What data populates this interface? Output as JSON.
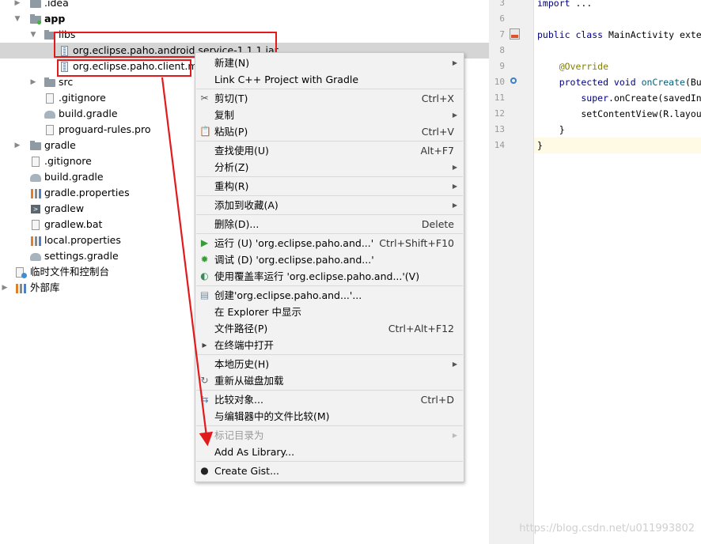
{
  "tree": {
    "items": [
      {
        "label": ".idea",
        "icon": "folder-icon"
      },
      {
        "label": "app",
        "icon": "module-folder-icon"
      },
      {
        "label": "libs",
        "icon": "folder-icon"
      },
      {
        "label": "org.eclipse.paho.android.service-1.1.1.jar",
        "icon": "jar-icon"
      },
      {
        "label": "org.eclipse.paho.client.mqt",
        "icon": "jar-icon"
      },
      {
        "label": "src",
        "icon": "folder-icon"
      },
      {
        "label": ".gitignore",
        "icon": "gitignore-file-icon"
      },
      {
        "label": "build.gradle",
        "icon": "gradle-icon"
      },
      {
        "label": "proguard-rules.pro",
        "icon": "text-file-icon"
      },
      {
        "label": "gradle",
        "icon": "folder-icon"
      },
      {
        "label": ".gitignore",
        "icon": "gitignore-file-icon"
      },
      {
        "label": "build.gradle",
        "icon": "gradle-icon"
      },
      {
        "label": "gradle.properties",
        "icon": "properties-file-icon"
      },
      {
        "label": "gradlew",
        "icon": "terminal-file-icon"
      },
      {
        "label": "gradlew.bat",
        "icon": "text-file-icon"
      },
      {
        "label": "local.properties",
        "icon": "properties-file-icon"
      },
      {
        "label": "settings.gradle",
        "icon": "gradle-icon"
      },
      {
        "label": "临时文件和控制台",
        "icon": "scratches-icon"
      },
      {
        "label": "外部库",
        "icon": "external-libraries-icon"
      }
    ]
  },
  "editor": {
    "line_numbers": [
      "3",
      "6",
      "7",
      "8",
      "9",
      "10",
      "11",
      "12",
      "13",
      "14"
    ],
    "lines": [
      {
        "tokens": [
          {
            "t": "import ",
            "c": "kw"
          },
          {
            "t": "...",
            "c": ""
          }
        ]
      },
      {
        "tokens": []
      },
      {
        "tokens": [
          {
            "t": "public class ",
            "c": "kw"
          },
          {
            "t": "MainActivity exte",
            "c": ""
          }
        ]
      },
      {
        "tokens": []
      },
      {
        "tokens": [
          {
            "t": "    @Override",
            "c": "ann"
          }
        ]
      },
      {
        "tokens": [
          {
            "t": "    protected void ",
            "c": "kw"
          },
          {
            "t": "onCreate",
            "c": "fn"
          },
          {
            "t": "(Bu",
            "c": ""
          }
        ]
      },
      {
        "tokens": [
          {
            "t": "        super",
            "c": "kw"
          },
          {
            "t": ".onCreate(savedIn",
            "c": ""
          }
        ]
      },
      {
        "tokens": [
          {
            "t": "        setContentView(R.layou",
            "c": ""
          }
        ]
      },
      {
        "tokens": [
          {
            "t": "    }",
            "c": ""
          }
        ]
      },
      {
        "tokens": [
          {
            "t": "}",
            "c": ""
          }
        ]
      }
    ]
  },
  "watermark": "https://blog.csdn.net/u011993802",
  "context_menu": {
    "items": [
      {
        "label": "新建(N)",
        "shortcut": "",
        "submenu": true,
        "icon": ""
      },
      {
        "label": "Link C++ Project with Gradle",
        "shortcut": "",
        "submenu": false,
        "icon": ""
      },
      {
        "label": "剪切(T)",
        "shortcut": "Ctrl+X",
        "submenu": false,
        "icon": "scissors-icon"
      },
      {
        "label": "复制",
        "shortcut": "",
        "submenu": true,
        "icon": ""
      },
      {
        "label": "粘贴(P)",
        "shortcut": "Ctrl+V",
        "submenu": false,
        "icon": "clipboard-icon"
      },
      {
        "label": "查找使用(U)",
        "shortcut": "Alt+F7",
        "submenu": false,
        "icon": ""
      },
      {
        "label": "分析(Z)",
        "shortcut": "",
        "submenu": true,
        "icon": ""
      },
      {
        "label": "重构(R)",
        "shortcut": "",
        "submenu": true,
        "icon": ""
      },
      {
        "label": "添加到收藏(A)",
        "shortcut": "",
        "submenu": true,
        "icon": ""
      },
      {
        "label": "删除(D)...",
        "shortcut": "Delete",
        "submenu": false,
        "icon": ""
      },
      {
        "label": "运行 (U) 'org.eclipse.paho.and...'",
        "shortcut": "Ctrl+Shift+F10",
        "submenu": false,
        "icon": "run-icon"
      },
      {
        "label": "调试 (D) 'org.eclipse.paho.and...'",
        "shortcut": "",
        "submenu": false,
        "icon": "debug-icon"
      },
      {
        "label": "使用覆盖率运行  'org.eclipse.paho.and...'(V)",
        "shortcut": "",
        "submenu": false,
        "icon": "coverage-icon"
      },
      {
        "label": "创建'org.eclipse.paho.and...'...",
        "shortcut": "",
        "submenu": false,
        "icon": "jar-icon"
      },
      {
        "label": "在 Explorer 中显示",
        "shortcut": "",
        "submenu": false,
        "icon": ""
      },
      {
        "label": "文件路径(P)",
        "shortcut": "Ctrl+Alt+F12",
        "submenu": false,
        "icon": ""
      },
      {
        "label": "在终端中打开",
        "shortcut": "",
        "submenu": false,
        "icon": "terminal-icon"
      },
      {
        "label": "本地历史(H)",
        "shortcut": "",
        "submenu": true,
        "icon": ""
      },
      {
        "label": "重新从磁盘加载",
        "shortcut": "",
        "submenu": false,
        "icon": "reload-icon"
      },
      {
        "label": "比较对象...",
        "shortcut": "Ctrl+D",
        "submenu": false,
        "icon": "compare-icon"
      },
      {
        "label": "与编辑器中的文件比较(M)",
        "shortcut": "",
        "submenu": false,
        "icon": ""
      },
      {
        "label": "标记目录为",
        "shortcut": "",
        "submenu": true,
        "icon": "",
        "disabled": true
      },
      {
        "label": "Add As Library...",
        "shortcut": "",
        "submenu": false,
        "icon": ""
      },
      {
        "label": "Create Gist...",
        "shortcut": "",
        "submenu": false,
        "icon": "github-icon"
      }
    ]
  },
  "colors": {
    "highlight_box": "#e31a1c",
    "annotation_arrow": "#e31a1c",
    "selection": "#d5d5d5",
    "menu_bg": "#f2f2f2"
  }
}
